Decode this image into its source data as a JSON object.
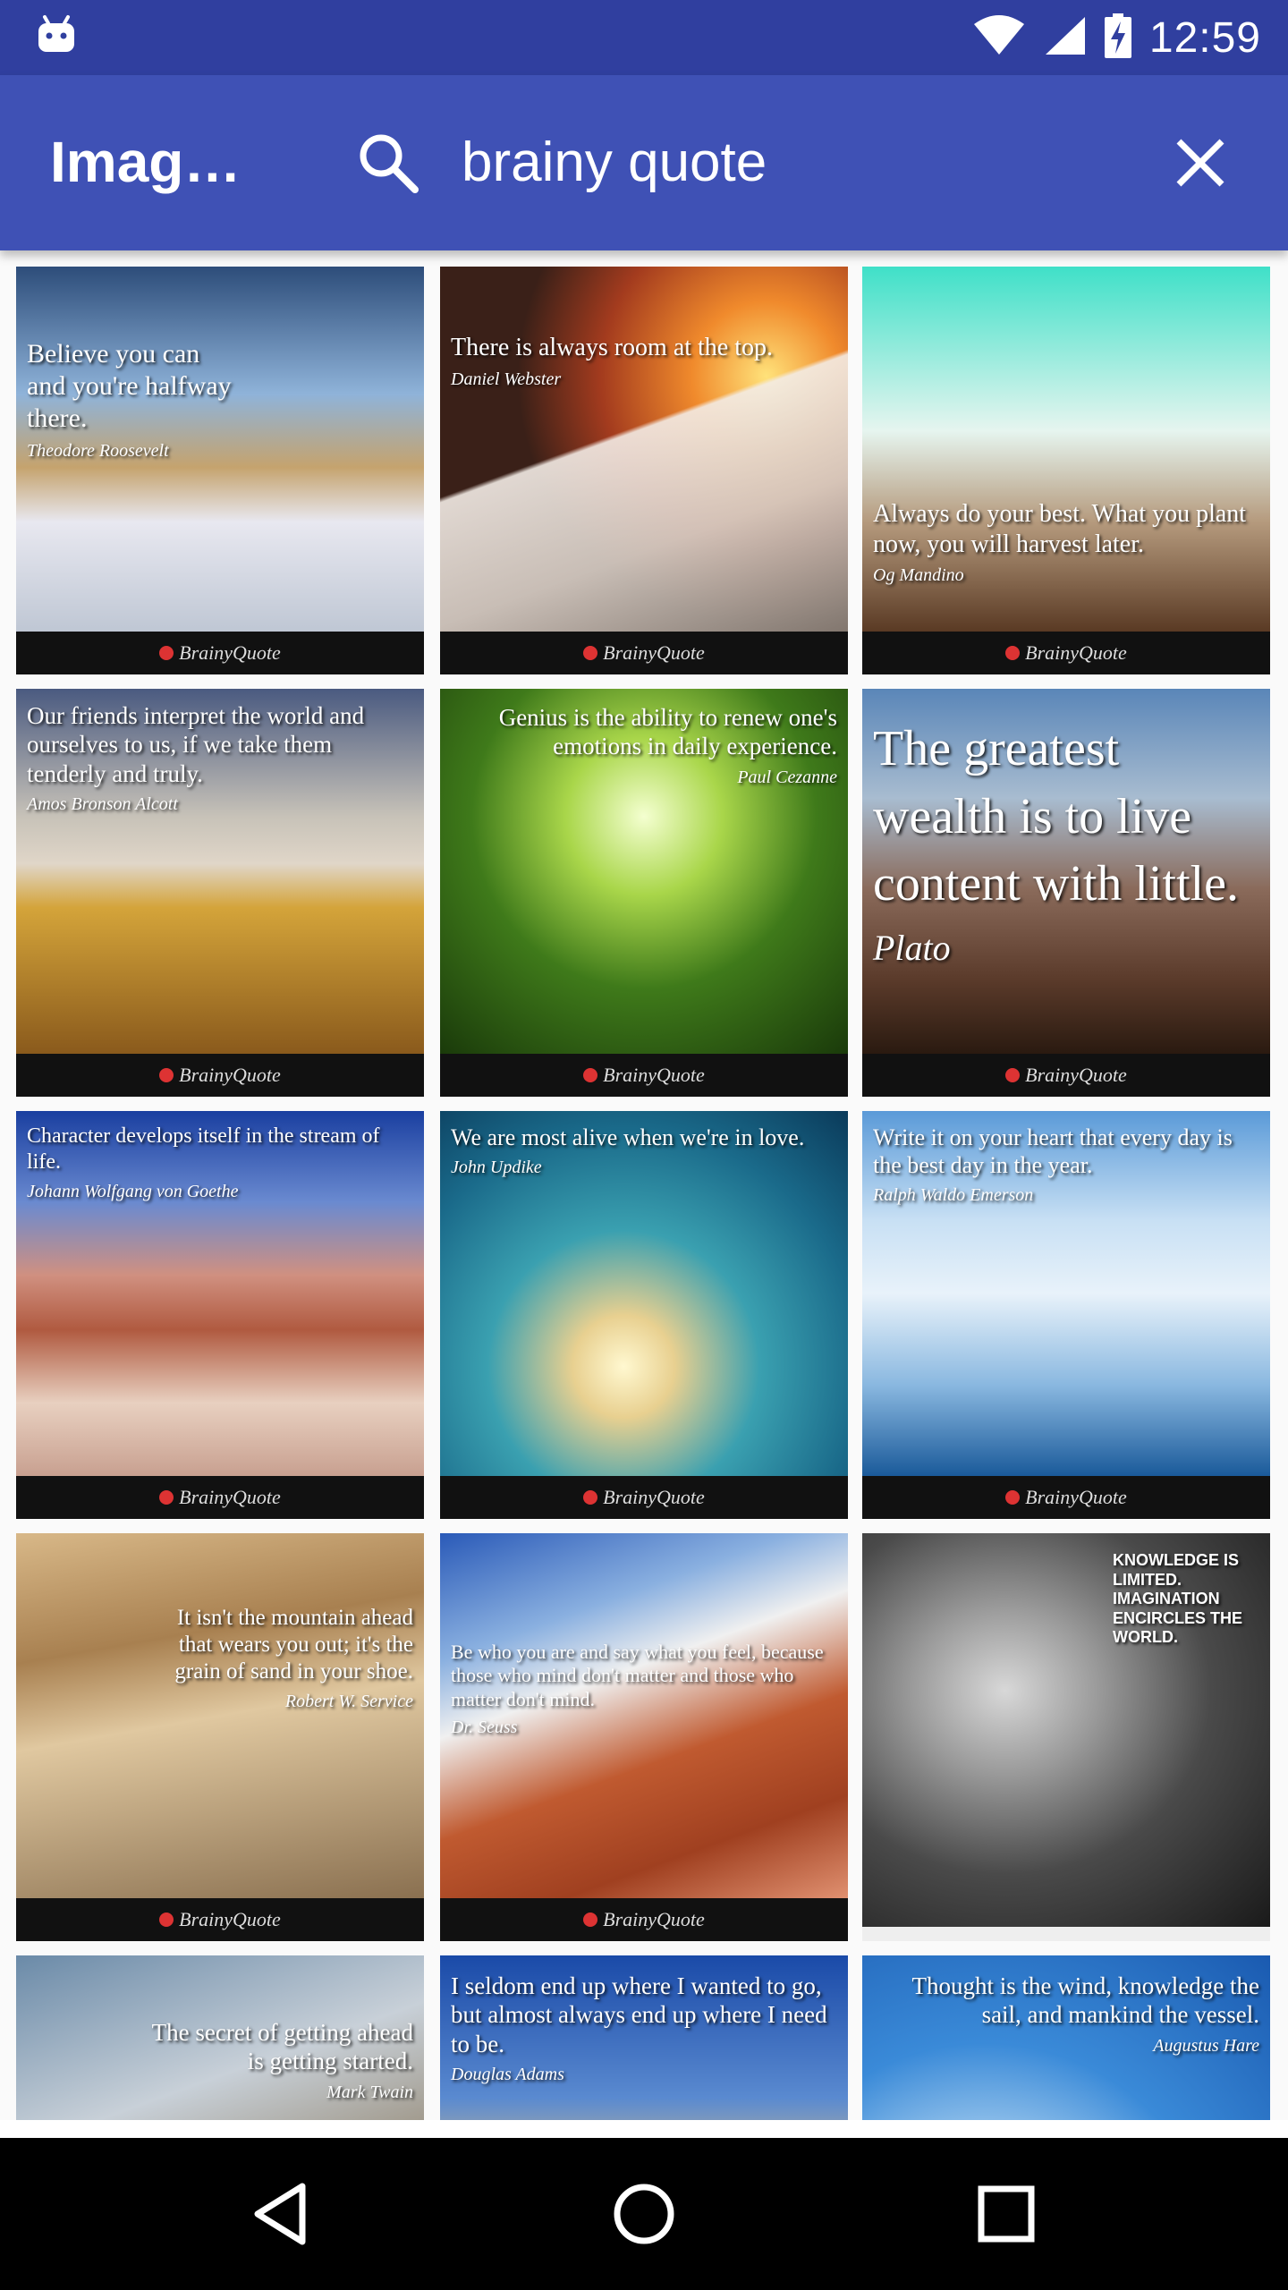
{
  "status_bar": {
    "time": "12:59",
    "icons": [
      "android-icon",
      "wifi-icon",
      "signal-icon",
      "battery-charging-icon"
    ]
  },
  "app_bar": {
    "title": "Imag…",
    "search_query": "brainy quote",
    "icons": [
      "search-icon",
      "close-icon"
    ]
  },
  "tiles": [
    {
      "caption": "Believe you can and you're halfway there.",
      "author": "Theodore Roosevelt",
      "footer": "BrainyQuote"
    },
    {
      "caption": "There is always room at the top.",
      "author": "Daniel Webster",
      "footer": "BrainyQuote"
    },
    {
      "caption": "Always do your best. What you plant now, you will harvest later.",
      "author": "Og Mandino",
      "footer": "BrainyQuote"
    },
    {
      "caption": "Our friends interpret the world and ourselves to us, if we take them tenderly and truly.",
      "author": "Amos Bronson Alcott",
      "footer": "BrainyQuote"
    },
    {
      "caption": "Genius is the ability to renew one's emotions in daily experience.",
      "author": "Paul Cezanne",
      "footer": "BrainyQuote"
    },
    {
      "caption": "The greatest wealth is to live content with little.",
      "author": "Plato",
      "footer": "BrainyQuote"
    },
    {
      "caption": "Character develops itself in the stream of life.",
      "author": "Johann Wolfgang von Goethe",
      "footer": "BrainyQuote"
    },
    {
      "caption": "We are most alive when we're in love.",
      "author": "John Updike",
      "footer": "BrainyQuote"
    },
    {
      "caption": "Write it on your heart that every day is the best day in the year.",
      "author": "Ralph Waldo Emerson",
      "footer": "BrainyQuote"
    },
    {
      "caption": "It isn't the mountain ahead that wears you out; it's the grain of sand in your shoe.",
      "author": "Robert W. Service",
      "footer": "BrainyQuote"
    },
    {
      "caption": "Be who you are and say what you feel, because those who mind don't matter and those who matter don't mind.",
      "author": "Dr. Seuss",
      "footer": "BrainyQuote"
    },
    {
      "caption": "KNOWLEDGE IS LIMITED. IMAGINATION ENCIRCLES THE WORLD.",
      "author": "",
      "footer": ""
    },
    {
      "caption": "The secret of getting ahead is getting started.",
      "author": "Mark Twain",
      "footer": ""
    },
    {
      "caption": "I seldom end up where I wanted to go, but almost always end up where I need to be.",
      "author": "Douglas Adams",
      "footer": ""
    },
    {
      "caption": "Thought is the wind, knowledge the sail, and mankind the vessel.",
      "author": "Augustus Hare",
      "footer": ""
    }
  ],
  "nav_bar": {
    "icons": [
      "back-icon",
      "home-icon",
      "recents-icon"
    ]
  },
  "colors": {
    "status_bar": "#303F9F",
    "app_bar": "#3F51B5",
    "nav_bar": "#000000"
  }
}
